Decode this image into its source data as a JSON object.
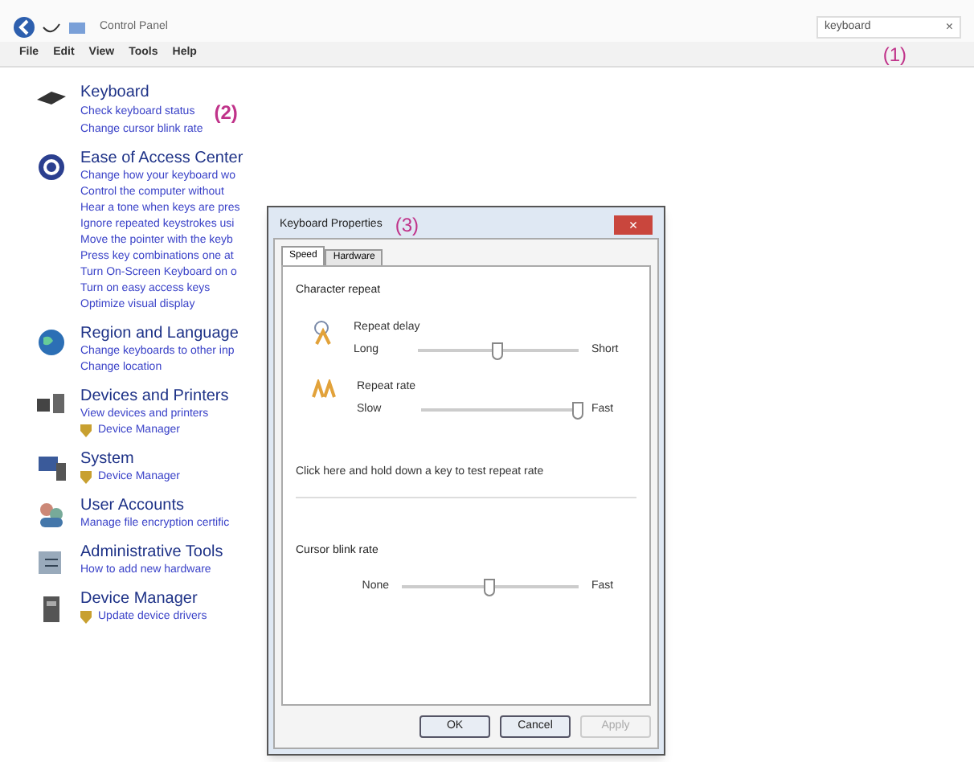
{
  "address_bar": {
    "breadcrumb": "Control Panel",
    "search_value": "keyboard",
    "clear_symbol": "×"
  },
  "menu": [
    "File",
    "Edit",
    "View",
    "Tools",
    "Help"
  ],
  "annotations": [
    {
      "label": "(1)"
    },
    {
      "label": "(2)"
    },
    {
      "label": "(3)"
    }
  ],
  "categories": [
    {
      "title": "Keyboard",
      "links": [
        {
          "text": "Check keyboard status",
          "shield": false
        },
        {
          "text": "Change cursor blink rate",
          "shield": false
        }
      ]
    },
    {
      "title": "Ease of Access Center",
      "links": [
        {
          "text": "Change how your keyboard wo",
          "shield": false
        },
        {
          "text": "Control the computer without",
          "shield": false
        },
        {
          "text": "Hear a tone when keys are pres",
          "shield": false
        },
        {
          "text": "Ignore repeated keystrokes usi",
          "shield": false
        },
        {
          "text": "Move the pointer with the keyb",
          "shield": false
        },
        {
          "text": "Press key combinations one at",
          "shield": false
        },
        {
          "text": "Turn On-Screen Keyboard on o",
          "shield": false
        },
        {
          "text": "Turn on easy access keys",
          "shield": false
        },
        {
          "text": "Optimize visual display",
          "shield": false
        }
      ]
    },
    {
      "title": "Region and Language",
      "links": [
        {
          "text": "Change keyboards to other inp",
          "shield": false
        },
        {
          "text": "Change location",
          "shield": false
        }
      ]
    },
    {
      "title": "Devices and Printers",
      "links": [
        {
          "text": "View devices and printers",
          "shield": false
        },
        {
          "text": "Device Manager",
          "shield": true
        }
      ]
    },
    {
      "title": "System",
      "links": [
        {
          "text": "Device Manager",
          "shield": true
        }
      ]
    },
    {
      "title": "User Accounts",
      "links": [
        {
          "text": "Manage file encryption certific",
          "shield": false
        }
      ]
    },
    {
      "title": "Administrative Tools",
      "links": [
        {
          "text": "How to add new hardware",
          "shield": false
        }
      ]
    },
    {
      "title": "Device Manager",
      "links": [
        {
          "text": "Update device drivers",
          "shield": true
        }
      ]
    }
  ],
  "dialog": {
    "title": "Keyboard Properties",
    "close_symbol": "×",
    "tabs": [
      {
        "label": "Speed",
        "selected": true
      },
      {
        "label": "Hardware",
        "selected": false
      }
    ],
    "group_1": "Character repeat",
    "sliders": [
      {
        "label": "Repeat delay",
        "min": "Long",
        "max": "Short",
        "level": 0.5
      },
      {
        "label": "Repeat rate",
        "min": "Slow",
        "max": "Fast",
        "level": 1
      }
    ],
    "test_label": "Click here and hold down a key to test repeat rate",
    "group_2": "Cursor blink rate",
    "blink_slider": {
      "min": "None",
      "max": "Fast",
      "level": 0.5
    },
    "buttons": [
      {
        "label": "OK",
        "disabled": false
      },
      {
        "label": "Cancel",
        "disabled": false
      },
      {
        "label": "Apply",
        "disabled": true
      }
    ]
  }
}
